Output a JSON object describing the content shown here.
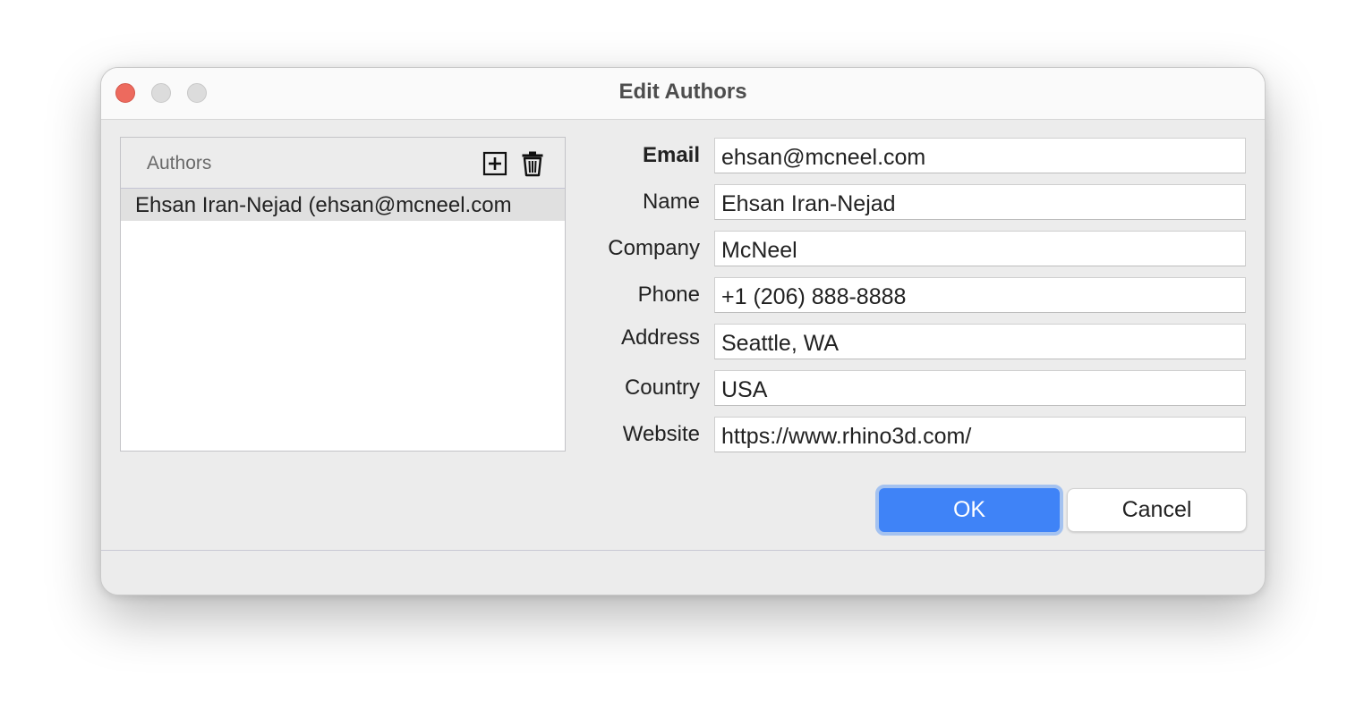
{
  "window": {
    "title": "Edit Authors"
  },
  "authors_panel": {
    "header_label": "Authors",
    "add_icon": "plus-box-icon",
    "delete_icon": "trash-icon",
    "items": [
      {
        "label": "Ehsan Iran-Nejad (ehsan@mcneel.com"
      }
    ]
  },
  "form": {
    "fields": [
      {
        "label": "Email",
        "value": "ehsan@mcneel.com"
      },
      {
        "label": "Name",
        "value": "Ehsan Iran-Nejad"
      },
      {
        "label": "Company",
        "value": "McNeel"
      },
      {
        "label": "Phone",
        "value": "+1 (206) 888-8888"
      },
      {
        "label": "Address",
        "value": "Seattle, WA"
      },
      {
        "label": "Country",
        "value": "USA"
      },
      {
        "label": "Website",
        "value": "https://www.rhino3d.com/"
      }
    ]
  },
  "buttons": {
    "ok_label": "OK",
    "cancel_label": "Cancel"
  },
  "colors": {
    "accent": "#3f83f7",
    "close_button": "#ed6a5e"
  }
}
